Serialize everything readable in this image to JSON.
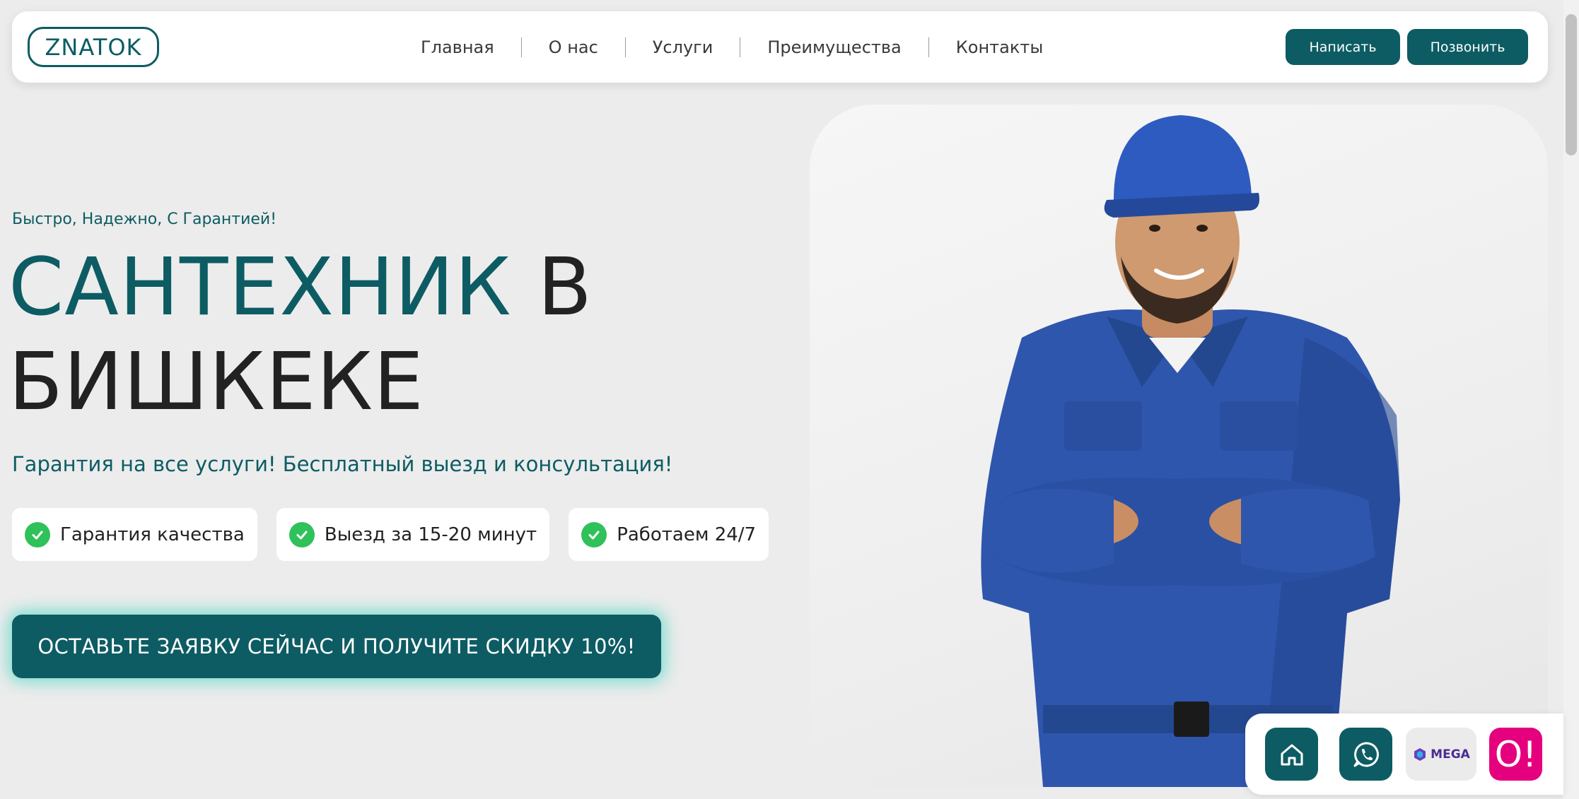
{
  "header": {
    "logo": "ZNATOK",
    "nav": [
      "Главная",
      "О нас",
      "Услуги",
      "Преимущества",
      "Контакты"
    ],
    "write_label": "Написать",
    "call_label": "Позвонить"
  },
  "hero": {
    "tagline": "Быстро, Надежно, С Гарантией!",
    "title_accent": "САНТЕХНИК",
    "title_rest_line1": "В",
    "title_line2": "БИШКЕКЕ",
    "subtitle": "Гарантия на все услуги! Бесплатный выезд и консультация!",
    "features": [
      "Гарантия качества",
      "Выезд за 15-20 минут",
      "Работаем 24/7"
    ],
    "cta_label": "ОСТАВЬТЕ ЗАЯВКУ СЕЙЧАС И ПОЛУЧИТЕ СКИДКУ 10%!"
  },
  "float_panel": {
    "mega_label": "MEGA",
    "o_label": "O!"
  },
  "colors": {
    "brand": "#0d5c63",
    "check_green": "#2fc15a",
    "o_magenta": "#e5007d",
    "uniform_blue": "#2e56ad"
  },
  "icons": [
    "home-icon",
    "whatsapp-icon",
    "mega-logo-icon",
    "check-icon"
  ]
}
